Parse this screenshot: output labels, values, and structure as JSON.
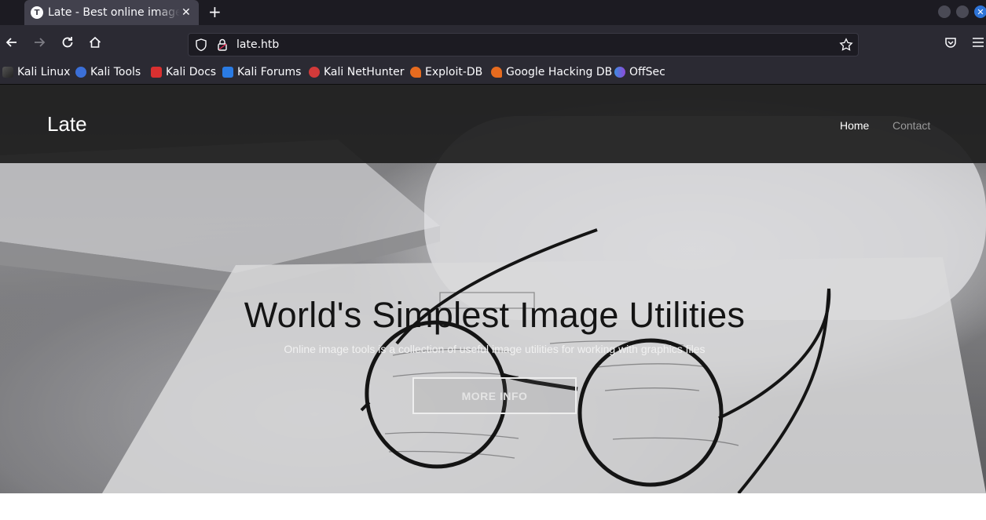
{
  "browser": {
    "tab": {
      "favicon": "T",
      "title": "Late - Best online image tools",
      "close": "✕"
    },
    "new_tab": "+",
    "window_close": "✕",
    "url": "late.htb",
    "bookmarks": [
      {
        "label": "Kali Linux",
        "icon": "kali-dragon-icon",
        "color": "#2e2e2e"
      },
      {
        "label": "Kali Tools",
        "icon": "kali-tools-icon",
        "color": "#3b6fd8"
      },
      {
        "label": "Kali Docs",
        "icon": "kali-docs-icon",
        "color": "#d93030"
      },
      {
        "label": "Kali Forums",
        "icon": "kali-forums-icon",
        "color": "#2a7be4"
      },
      {
        "label": "Kali NetHunter",
        "icon": "kali-nethunter-icon",
        "color": "#d23a3a"
      },
      {
        "label": "Exploit-DB",
        "icon": "exploit-db-icon",
        "color": "#e66b1f"
      },
      {
        "label": "Google Hacking DB",
        "icon": "ghdb-icon",
        "color": "#e66b1f"
      },
      {
        "label": "OffSec",
        "icon": "offsec-icon",
        "color": "#6b5cd9"
      }
    ]
  },
  "site": {
    "logo": "Late",
    "nav": {
      "home": "Home",
      "contact": "Contact"
    },
    "hero": {
      "title": "World's Simplest Image Utilities",
      "subtitle": "Online image tools is a collection of useful image utilities for working with graphics files",
      "button": "MORE INFO"
    }
  }
}
